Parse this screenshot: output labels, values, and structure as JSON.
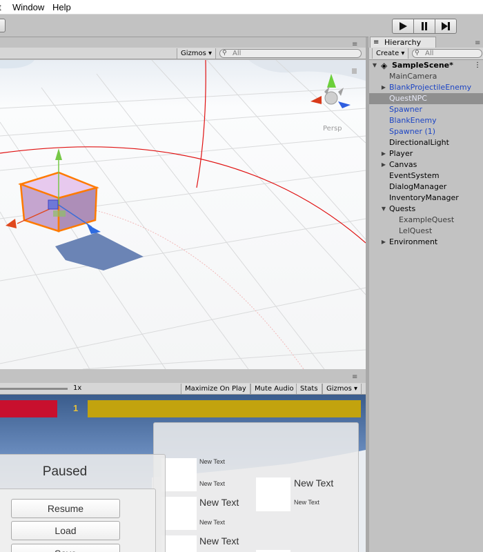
{
  "menu": {
    "items": [
      "t",
      "Window",
      "Help"
    ]
  },
  "toolbar": {
    "play": "play",
    "pause": "pause",
    "step": "step"
  },
  "scene": {
    "gizmos_label": "Gizmos",
    "search_placeholder": "All",
    "persp_label": "Persp"
  },
  "hierarchy": {
    "tab_label": "Hierarchy",
    "create_label": "Create",
    "search_placeholder": "All",
    "scene_name": "SampleScene*",
    "items": [
      {
        "label": "MainCamera",
        "indent": 1,
        "arrow": "",
        "color": "#3c3c3c",
        "selected": false
      },
      {
        "label": "BlankProjectileEnemy",
        "indent": 1,
        "arrow": "right",
        "color": "#1d45c4",
        "selected": false
      },
      {
        "label": "QuestNPC",
        "indent": 1,
        "arrow": "",
        "color": "#e8eaf8",
        "selected": true
      },
      {
        "label": "Spawner",
        "indent": 1,
        "arrow": "",
        "color": "#1d45c4",
        "selected": false
      },
      {
        "label": "BlankEnemy",
        "indent": 1,
        "arrow": "",
        "color": "#1d45c4",
        "selected": false
      },
      {
        "label": "Spawner (1)",
        "indent": 1,
        "arrow": "",
        "color": "#1d45c4",
        "selected": false
      },
      {
        "label": "DirectionalLight",
        "indent": 1,
        "arrow": "",
        "color": "#000000",
        "selected": false
      },
      {
        "label": "Player",
        "indent": 1,
        "arrow": "right",
        "color": "#000000",
        "selected": false
      },
      {
        "label": "Canvas",
        "indent": 1,
        "arrow": "right",
        "color": "#000000",
        "selected": false
      },
      {
        "label": "EventSystem",
        "indent": 1,
        "arrow": "",
        "color": "#000000",
        "selected": false
      },
      {
        "label": "DialogManager",
        "indent": 1,
        "arrow": "",
        "color": "#000000",
        "selected": false
      },
      {
        "label": "InventoryManager",
        "indent": 1,
        "arrow": "",
        "color": "#000000",
        "selected": false
      },
      {
        "label": "Quests",
        "indent": 1,
        "arrow": "down",
        "color": "#000000",
        "selected": false
      },
      {
        "label": "ExampleQuest",
        "indent": 2,
        "arrow": "",
        "color": "#3c3c3c",
        "selected": false
      },
      {
        "label": "LelQuest",
        "indent": 2,
        "arrow": "",
        "color": "#3c3c3c",
        "selected": false
      },
      {
        "label": "Environment",
        "indent": 1,
        "arrow": "right",
        "color": "#000000",
        "selected": false
      }
    ]
  },
  "game": {
    "scale_label": "1x",
    "buttons": [
      "Maximize On Play",
      "Mute Audio",
      "Stats",
      "Gizmos"
    ],
    "hud_level": "1",
    "health_color": "#c8102e",
    "xp_color": "#c2a30e",
    "pause_menu": {
      "title": "Paused",
      "resume": "Resume",
      "load": "Load",
      "save": "Save"
    },
    "inventory": {
      "small_text": "New Text",
      "big_text": "New Text"
    }
  },
  "colors": {
    "selection": "#8f8f8f",
    "prefab_blue": "#1d45c4"
  }
}
